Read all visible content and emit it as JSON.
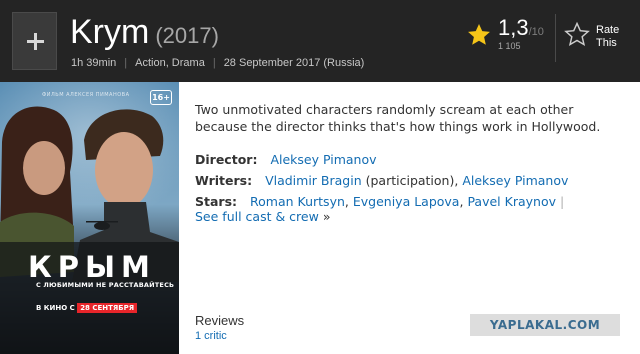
{
  "header": {
    "title": "Krym",
    "year": "(2017)",
    "runtime": "1h 39min",
    "genres": "Action, Drama",
    "release": "28 September 2017 (Russia)",
    "add_icon": "plus-icon"
  },
  "rating": {
    "value": "1,3",
    "max": "/10",
    "count": "1 105",
    "star_icon": "star-icon",
    "star_color": "#f5c518"
  },
  "rate": {
    "label_line1": "Rate",
    "label_line2": "This",
    "icon": "star-outline-icon"
  },
  "poster": {
    "credit": "ФИЛЬМ АЛЕКСЕЯ ПИМАНОВА",
    "age": "16+",
    "title": "КРЫМ",
    "tagline": "С ЛЮБИМЫМИ НЕ РАССТАВАЙТЕСЬ",
    "release_prefix": "В КИНО С",
    "release_date": "28 СЕНТЯБРЯ"
  },
  "summary": "Two unmotivated characters randomly scream at each other because the director thinks that's how things work in Hollywood.",
  "credits": {
    "director_label": "Director:",
    "director": "Aleksey Pimanov",
    "writers_label": "Writers:",
    "writer1": "Vladimir Bragin",
    "writer1_note": "(participation),",
    "writer2": "Aleksey Pimanov",
    "stars_label": "Stars:",
    "star1": "Roman Kurtsyn",
    "star2": "Evgeniya Lapova",
    "star3": "Pavel Kraynov",
    "full_cast": "See full cast & crew",
    "chevron": "»"
  },
  "reviews": {
    "label": "Reviews",
    "critic": "1 critic"
  },
  "watermark": "YAPLAKAL.COM",
  "colors": {
    "header_bg": "#242424",
    "link": "#136cb2",
    "poster_red": "#e8252a"
  }
}
